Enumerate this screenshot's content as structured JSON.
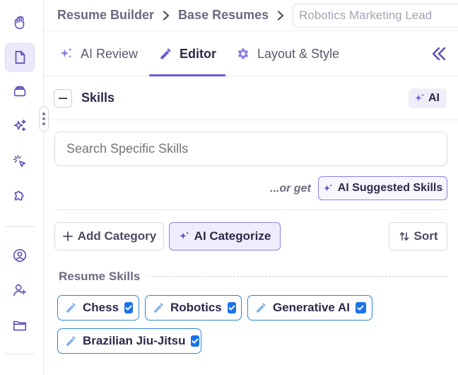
{
  "breadcrumb": {
    "items": [
      "Resume Builder",
      "Base Resumes"
    ],
    "current_value": "Robotics Marketing Lead"
  },
  "tabs": [
    {
      "label": "AI Review",
      "icon": "sparkles-icon",
      "active": false
    },
    {
      "label": "Editor",
      "icon": "pencil-icon",
      "active": true
    },
    {
      "label": "Layout & Style",
      "icon": "gear-icon",
      "active": false
    }
  ],
  "section": {
    "title": "Skills",
    "ai_badge": "AI"
  },
  "search": {
    "placeholder": "Search Specific Skills"
  },
  "suggest": {
    "or_get": "...or get",
    "button": "AI Suggested Skills"
  },
  "actions": {
    "add_category": "Add Category",
    "ai_categorize": "AI Categorize",
    "sort": "Sort"
  },
  "resume_skills": {
    "label": "Resume Skills",
    "items": [
      {
        "label": "Chess",
        "checked": true
      },
      {
        "label": "Robotics",
        "checked": true
      },
      {
        "label": "Generative AI",
        "checked": true
      },
      {
        "label": "Brazilian Jiu-Jitsu",
        "checked": true
      }
    ]
  },
  "sidebar": {
    "icons": [
      "hand-icon",
      "document-icon",
      "stack-icon",
      "sparkles-icon",
      "click-icon",
      "puzzle-icon",
      "user-circle-icon",
      "add-user-icon",
      "folder-icon"
    ]
  },
  "colors": {
    "accent": "#6c5ce0",
    "chip_border": "#2f86d6",
    "checkbox": "#1a73e8"
  }
}
